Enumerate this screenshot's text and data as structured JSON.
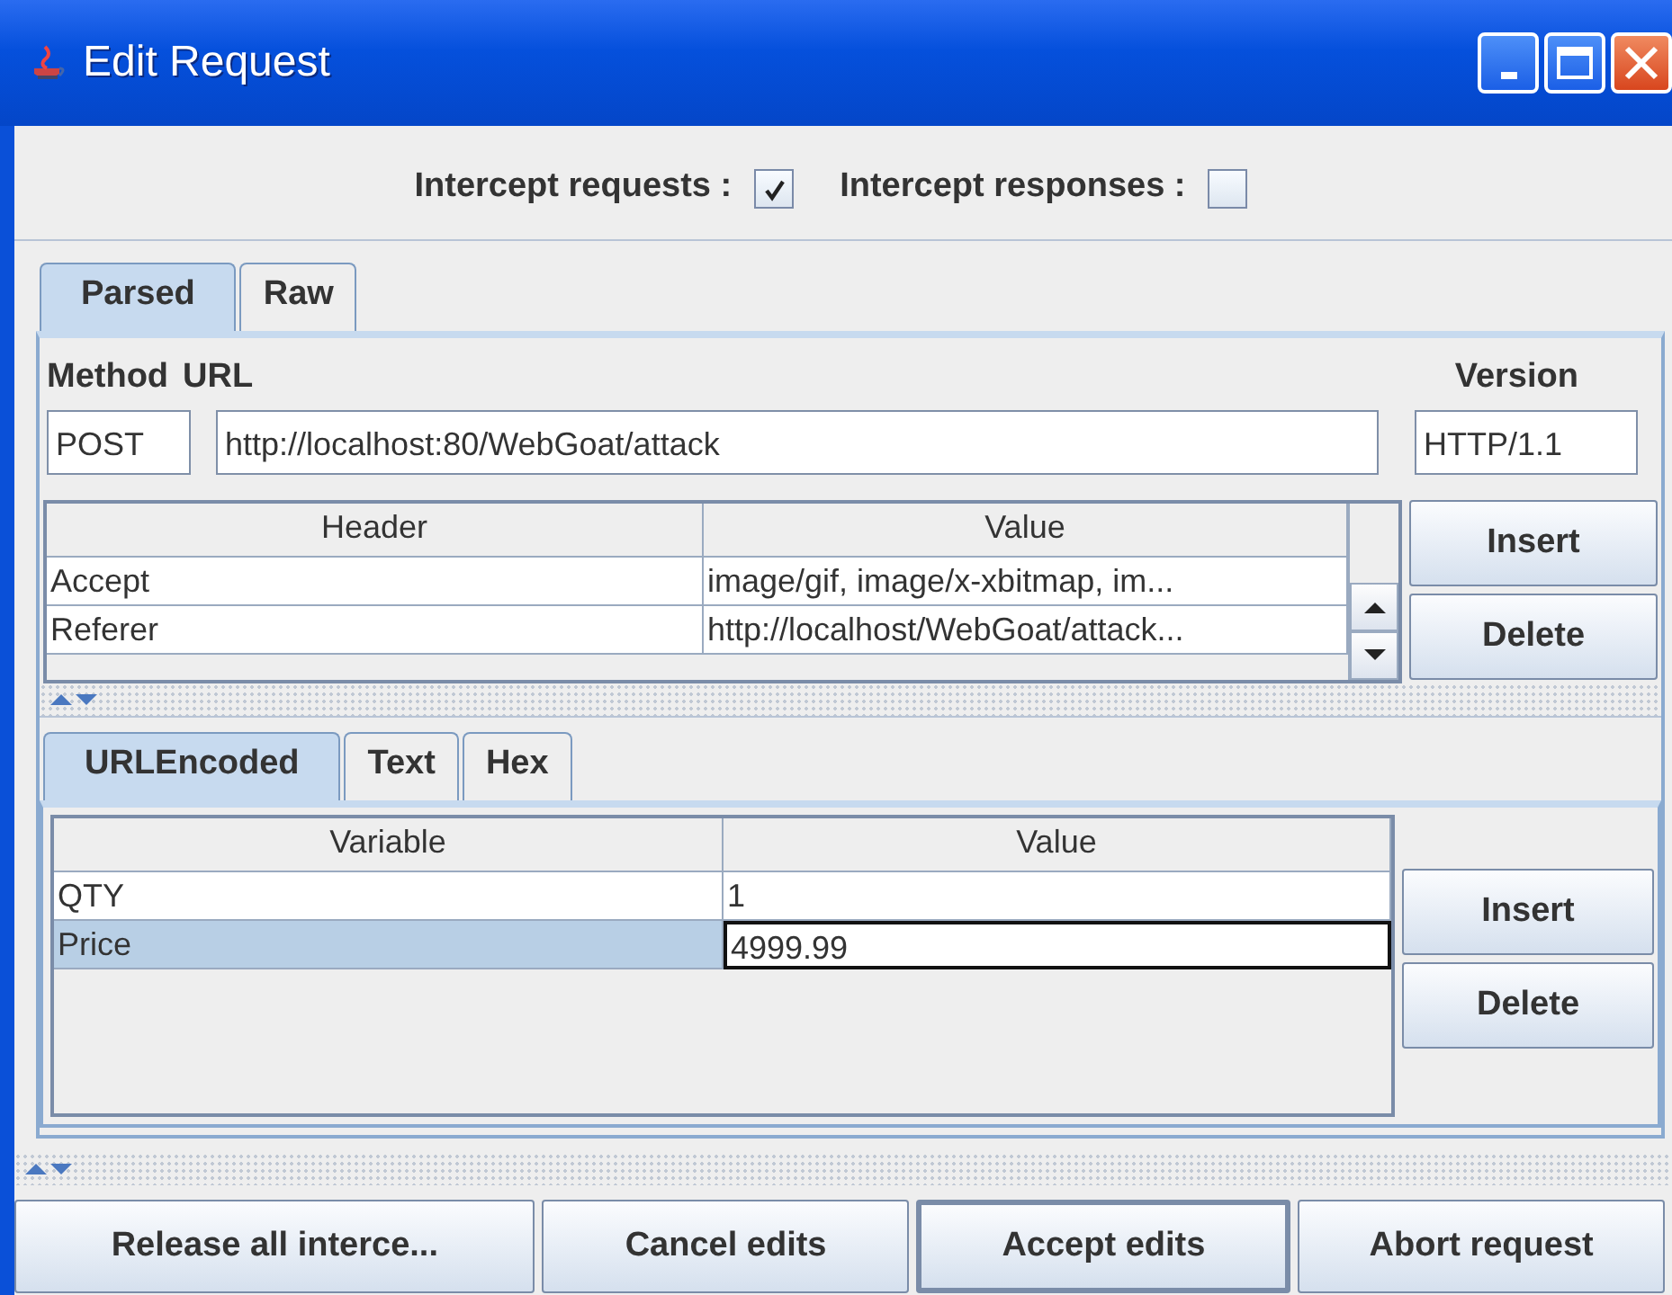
{
  "window": {
    "title": "Edit Request"
  },
  "intercept": [
    {
      "label": "Intercept requests :",
      "checked": true
    },
    {
      "label": "Intercept responses :",
      "checked": false
    }
  ],
  "tabs": [
    {
      "label": "Parsed",
      "selected": true
    },
    {
      "label": "Raw",
      "selected": false
    }
  ],
  "request": {
    "method_label": "Method",
    "url_label": "URL",
    "version_label": "Version",
    "method": "POST",
    "url": "http://localhost:80/WebGoat/attack",
    "version": "HTTP/1.1"
  },
  "headers": {
    "columns": [
      "Header",
      "Value"
    ],
    "rows": [
      {
        "name": "Accept",
        "value": "image/gif, image/x-xbitmap, im..."
      },
      {
        "name": "Referer",
        "value": "http://localhost/WebGoat/attack..."
      }
    ],
    "buttons": [
      "Insert",
      "Delete"
    ]
  },
  "body_tabs": [
    {
      "label": "URLEncoded",
      "selected": true
    },
    {
      "label": "Text",
      "selected": false
    },
    {
      "label": "Hex",
      "selected": false
    }
  ],
  "variables": {
    "columns": [
      "Variable",
      "Value"
    ],
    "rows": [
      {
        "name": "QTY",
        "value": "1",
        "selected": false,
        "editing": false
      },
      {
        "name": "Price",
        "value": "4999.99",
        "selected": true,
        "editing": true
      }
    ],
    "buttons": [
      "Insert",
      "Delete"
    ]
  },
  "footer_buttons": [
    {
      "label": "Release all interce...",
      "default": false
    },
    {
      "label": "Cancel edits",
      "default": false
    },
    {
      "label": "Accept edits",
      "default": true
    },
    {
      "label": "Abort request",
      "default": false
    }
  ]
}
